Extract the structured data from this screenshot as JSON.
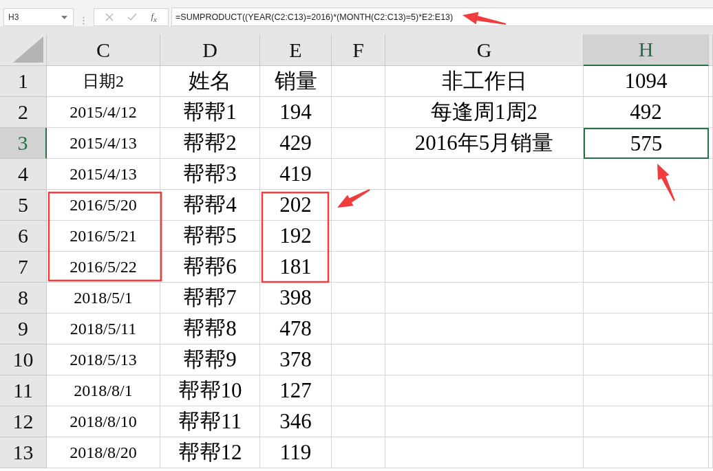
{
  "name_box": "H3",
  "function_label": "f$_{x}$",
  "formula": "=SUMPRODUCT((YEAR(C2:C13)=2016)*(MONTH(C2:C13)=5)*E2:E13)",
  "columns": [
    {
      "label": "C",
      "selected": false
    },
    {
      "label": "D",
      "selected": false
    },
    {
      "label": "E",
      "selected": false
    },
    {
      "label": "F",
      "selected": false
    },
    {
      "label": "G",
      "selected": false
    },
    {
      "label": "H",
      "selected": true
    }
  ],
  "rows": [
    {
      "number": "1",
      "selected": false,
      "cells": [
        "日期2",
        "姓名",
        "销量",
        null,
        "非工作日",
        "1094"
      ]
    },
    {
      "number": "2",
      "selected": false,
      "cells": [
        "2015/4/12",
        "帮帮1",
        "194",
        null,
        "每逢周1周2",
        "492"
      ]
    },
    {
      "number": "3",
      "selected": true,
      "cells": [
        "2015/4/13",
        "帮帮2",
        "429",
        null,
        "2016年5月销量",
        "575"
      ]
    },
    {
      "number": "4",
      "selected": false,
      "cells": [
        "2015/4/13",
        "帮帮3",
        "419",
        null,
        null,
        null
      ]
    },
    {
      "number": "5",
      "selected": false,
      "cells": [
        "2016/5/20",
        "帮帮4",
        "202",
        null,
        null,
        null
      ]
    },
    {
      "number": "6",
      "selected": false,
      "cells": [
        "2016/5/21",
        "帮帮5",
        "192",
        null,
        null,
        null
      ]
    },
    {
      "number": "7",
      "selected": false,
      "cells": [
        "2016/5/22",
        "帮帮6",
        "181",
        null,
        null,
        null
      ]
    },
    {
      "number": "8",
      "selected": false,
      "cells": [
        "2018/5/1",
        "帮帮7",
        "398",
        null,
        null,
        null
      ]
    },
    {
      "number": "9",
      "selected": false,
      "cells": [
        "2018/5/11",
        "帮帮8",
        "478",
        null,
        null,
        null
      ]
    },
    {
      "number": "10",
      "selected": false,
      "cells": [
        "2018/5/13",
        "帮帮9",
        "378",
        null,
        null,
        null
      ]
    },
    {
      "number": "11",
      "selected": false,
      "cells": [
        "2018/8/1",
        "帮帮10",
        "127",
        null,
        null,
        null
      ]
    },
    {
      "number": "12",
      "selected": false,
      "cells": [
        "2018/8/10",
        "帮帮11",
        "346",
        null,
        null,
        null
      ]
    },
    {
      "number": "13",
      "selected": false,
      "cells": [
        "2018/8/20",
        "帮帮12",
        "119",
        null,
        null,
        null
      ]
    }
  ]
}
